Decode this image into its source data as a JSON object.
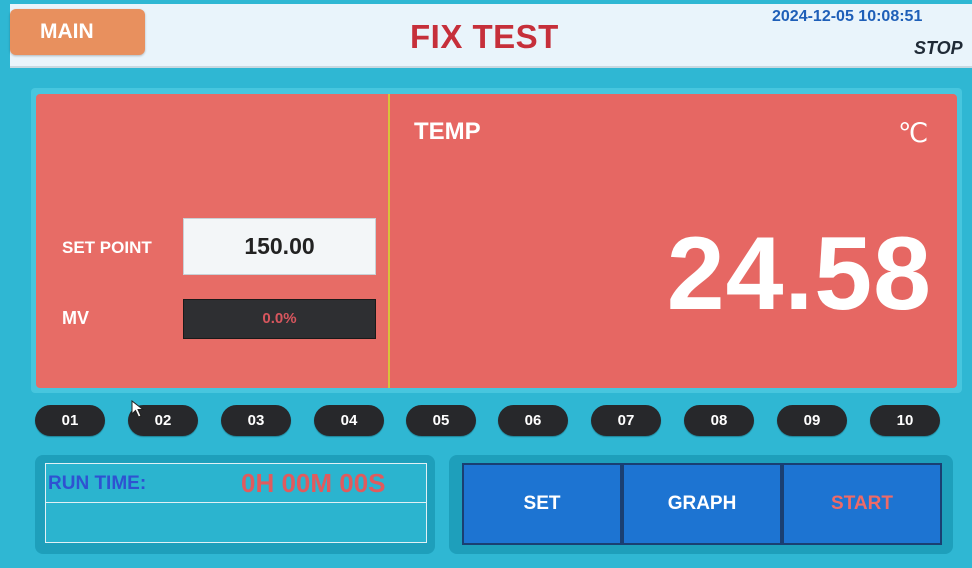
{
  "header": {
    "main_button": "MAIN",
    "title": "FIX TEST",
    "datetime": "2024-12-05 10:08:51",
    "status": "STOP"
  },
  "setpoint": {
    "label": "SET POINT",
    "value": "150.00"
  },
  "mv": {
    "label": "MV",
    "value": "0.0%"
  },
  "temperature": {
    "label": "TEMP",
    "unit": "℃",
    "value": "24.58"
  },
  "channels": [
    "01",
    "02",
    "03",
    "04",
    "05",
    "06",
    "07",
    "08",
    "09",
    "10"
  ],
  "runtime": {
    "label": "RUN TIME:",
    "value": "0H 00M 00S"
  },
  "buttons": {
    "set": "SET",
    "graph": "GRAPH",
    "start": "START"
  },
  "colors": {
    "background": "#2fb7d3",
    "panel_red": "#e66763",
    "button_blue": "#1d74d2",
    "channel_dark": "#27282b",
    "title_red": "#c62f3a",
    "main_button_orange": "#e8905e"
  }
}
